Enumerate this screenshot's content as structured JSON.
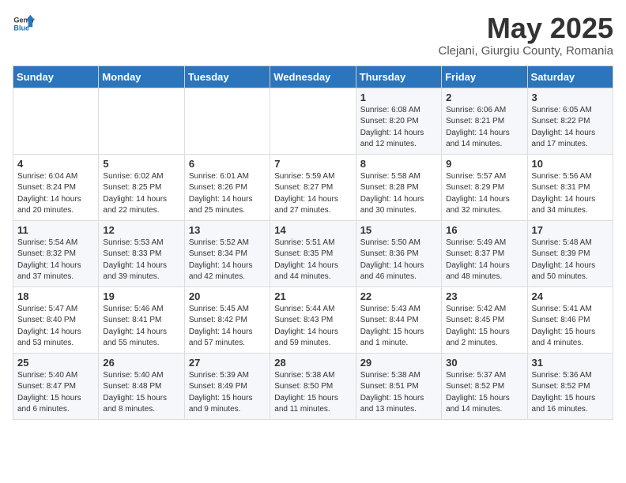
{
  "header": {
    "logo_general": "General",
    "logo_blue": "Blue",
    "month": "May 2025",
    "location": "Clejani, Giurgiu County, Romania"
  },
  "weekdays": [
    "Sunday",
    "Monday",
    "Tuesday",
    "Wednesday",
    "Thursday",
    "Friday",
    "Saturday"
  ],
  "weeks": [
    [
      {
        "day": "",
        "info": ""
      },
      {
        "day": "",
        "info": ""
      },
      {
        "day": "",
        "info": ""
      },
      {
        "day": "",
        "info": ""
      },
      {
        "day": "1",
        "info": "Sunrise: 6:08 AM\nSunset: 8:20 PM\nDaylight: 14 hours\nand 12 minutes."
      },
      {
        "day": "2",
        "info": "Sunrise: 6:06 AM\nSunset: 8:21 PM\nDaylight: 14 hours\nand 14 minutes."
      },
      {
        "day": "3",
        "info": "Sunrise: 6:05 AM\nSunset: 8:22 PM\nDaylight: 14 hours\nand 17 minutes."
      }
    ],
    [
      {
        "day": "4",
        "info": "Sunrise: 6:04 AM\nSunset: 8:24 PM\nDaylight: 14 hours\nand 20 minutes."
      },
      {
        "day": "5",
        "info": "Sunrise: 6:02 AM\nSunset: 8:25 PM\nDaylight: 14 hours\nand 22 minutes."
      },
      {
        "day": "6",
        "info": "Sunrise: 6:01 AM\nSunset: 8:26 PM\nDaylight: 14 hours\nand 25 minutes."
      },
      {
        "day": "7",
        "info": "Sunrise: 5:59 AM\nSunset: 8:27 PM\nDaylight: 14 hours\nand 27 minutes."
      },
      {
        "day": "8",
        "info": "Sunrise: 5:58 AM\nSunset: 8:28 PM\nDaylight: 14 hours\nand 30 minutes."
      },
      {
        "day": "9",
        "info": "Sunrise: 5:57 AM\nSunset: 8:29 PM\nDaylight: 14 hours\nand 32 minutes."
      },
      {
        "day": "10",
        "info": "Sunrise: 5:56 AM\nSunset: 8:31 PM\nDaylight: 14 hours\nand 34 minutes."
      }
    ],
    [
      {
        "day": "11",
        "info": "Sunrise: 5:54 AM\nSunset: 8:32 PM\nDaylight: 14 hours\nand 37 minutes."
      },
      {
        "day": "12",
        "info": "Sunrise: 5:53 AM\nSunset: 8:33 PM\nDaylight: 14 hours\nand 39 minutes."
      },
      {
        "day": "13",
        "info": "Sunrise: 5:52 AM\nSunset: 8:34 PM\nDaylight: 14 hours\nand 42 minutes."
      },
      {
        "day": "14",
        "info": "Sunrise: 5:51 AM\nSunset: 8:35 PM\nDaylight: 14 hours\nand 44 minutes."
      },
      {
        "day": "15",
        "info": "Sunrise: 5:50 AM\nSunset: 8:36 PM\nDaylight: 14 hours\nand 46 minutes."
      },
      {
        "day": "16",
        "info": "Sunrise: 5:49 AM\nSunset: 8:37 PM\nDaylight: 14 hours\nand 48 minutes."
      },
      {
        "day": "17",
        "info": "Sunrise: 5:48 AM\nSunset: 8:39 PM\nDaylight: 14 hours\nand 50 minutes."
      }
    ],
    [
      {
        "day": "18",
        "info": "Sunrise: 5:47 AM\nSunset: 8:40 PM\nDaylight: 14 hours\nand 53 minutes."
      },
      {
        "day": "19",
        "info": "Sunrise: 5:46 AM\nSunset: 8:41 PM\nDaylight: 14 hours\nand 55 minutes."
      },
      {
        "day": "20",
        "info": "Sunrise: 5:45 AM\nSunset: 8:42 PM\nDaylight: 14 hours\nand 57 minutes."
      },
      {
        "day": "21",
        "info": "Sunrise: 5:44 AM\nSunset: 8:43 PM\nDaylight: 14 hours\nand 59 minutes."
      },
      {
        "day": "22",
        "info": "Sunrise: 5:43 AM\nSunset: 8:44 PM\nDaylight: 15 hours\nand 1 minute."
      },
      {
        "day": "23",
        "info": "Sunrise: 5:42 AM\nSunset: 8:45 PM\nDaylight: 15 hours\nand 2 minutes."
      },
      {
        "day": "24",
        "info": "Sunrise: 5:41 AM\nSunset: 8:46 PM\nDaylight: 15 hours\nand 4 minutes."
      }
    ],
    [
      {
        "day": "25",
        "info": "Sunrise: 5:40 AM\nSunset: 8:47 PM\nDaylight: 15 hours\nand 6 minutes."
      },
      {
        "day": "26",
        "info": "Sunrise: 5:40 AM\nSunset: 8:48 PM\nDaylight: 15 hours\nand 8 minutes."
      },
      {
        "day": "27",
        "info": "Sunrise: 5:39 AM\nSunset: 8:49 PM\nDaylight: 15 hours\nand 9 minutes."
      },
      {
        "day": "28",
        "info": "Sunrise: 5:38 AM\nSunset: 8:50 PM\nDaylight: 15 hours\nand 11 minutes."
      },
      {
        "day": "29",
        "info": "Sunrise: 5:38 AM\nSunset: 8:51 PM\nDaylight: 15 hours\nand 13 minutes."
      },
      {
        "day": "30",
        "info": "Sunrise: 5:37 AM\nSunset: 8:52 PM\nDaylight: 15 hours\nand 14 minutes."
      },
      {
        "day": "31",
        "info": "Sunrise: 5:36 AM\nSunset: 8:52 PM\nDaylight: 15 hours\nand 16 minutes."
      }
    ]
  ]
}
